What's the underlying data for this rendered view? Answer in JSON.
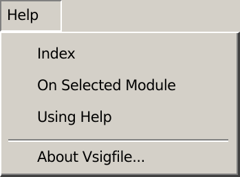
{
  "menubar": {
    "help_label": "Help"
  },
  "menu": {
    "items": [
      {
        "label": "Index"
      },
      {
        "label": "On Selected Module"
      },
      {
        "label": "Using Help"
      },
      {
        "label": "About Vsigfile..."
      }
    ]
  },
  "colors": {
    "face": "#d4d0c8",
    "highlight": "#ffffff",
    "shadow": "#808080",
    "dark_shadow": "#404040",
    "text": "#000000"
  }
}
